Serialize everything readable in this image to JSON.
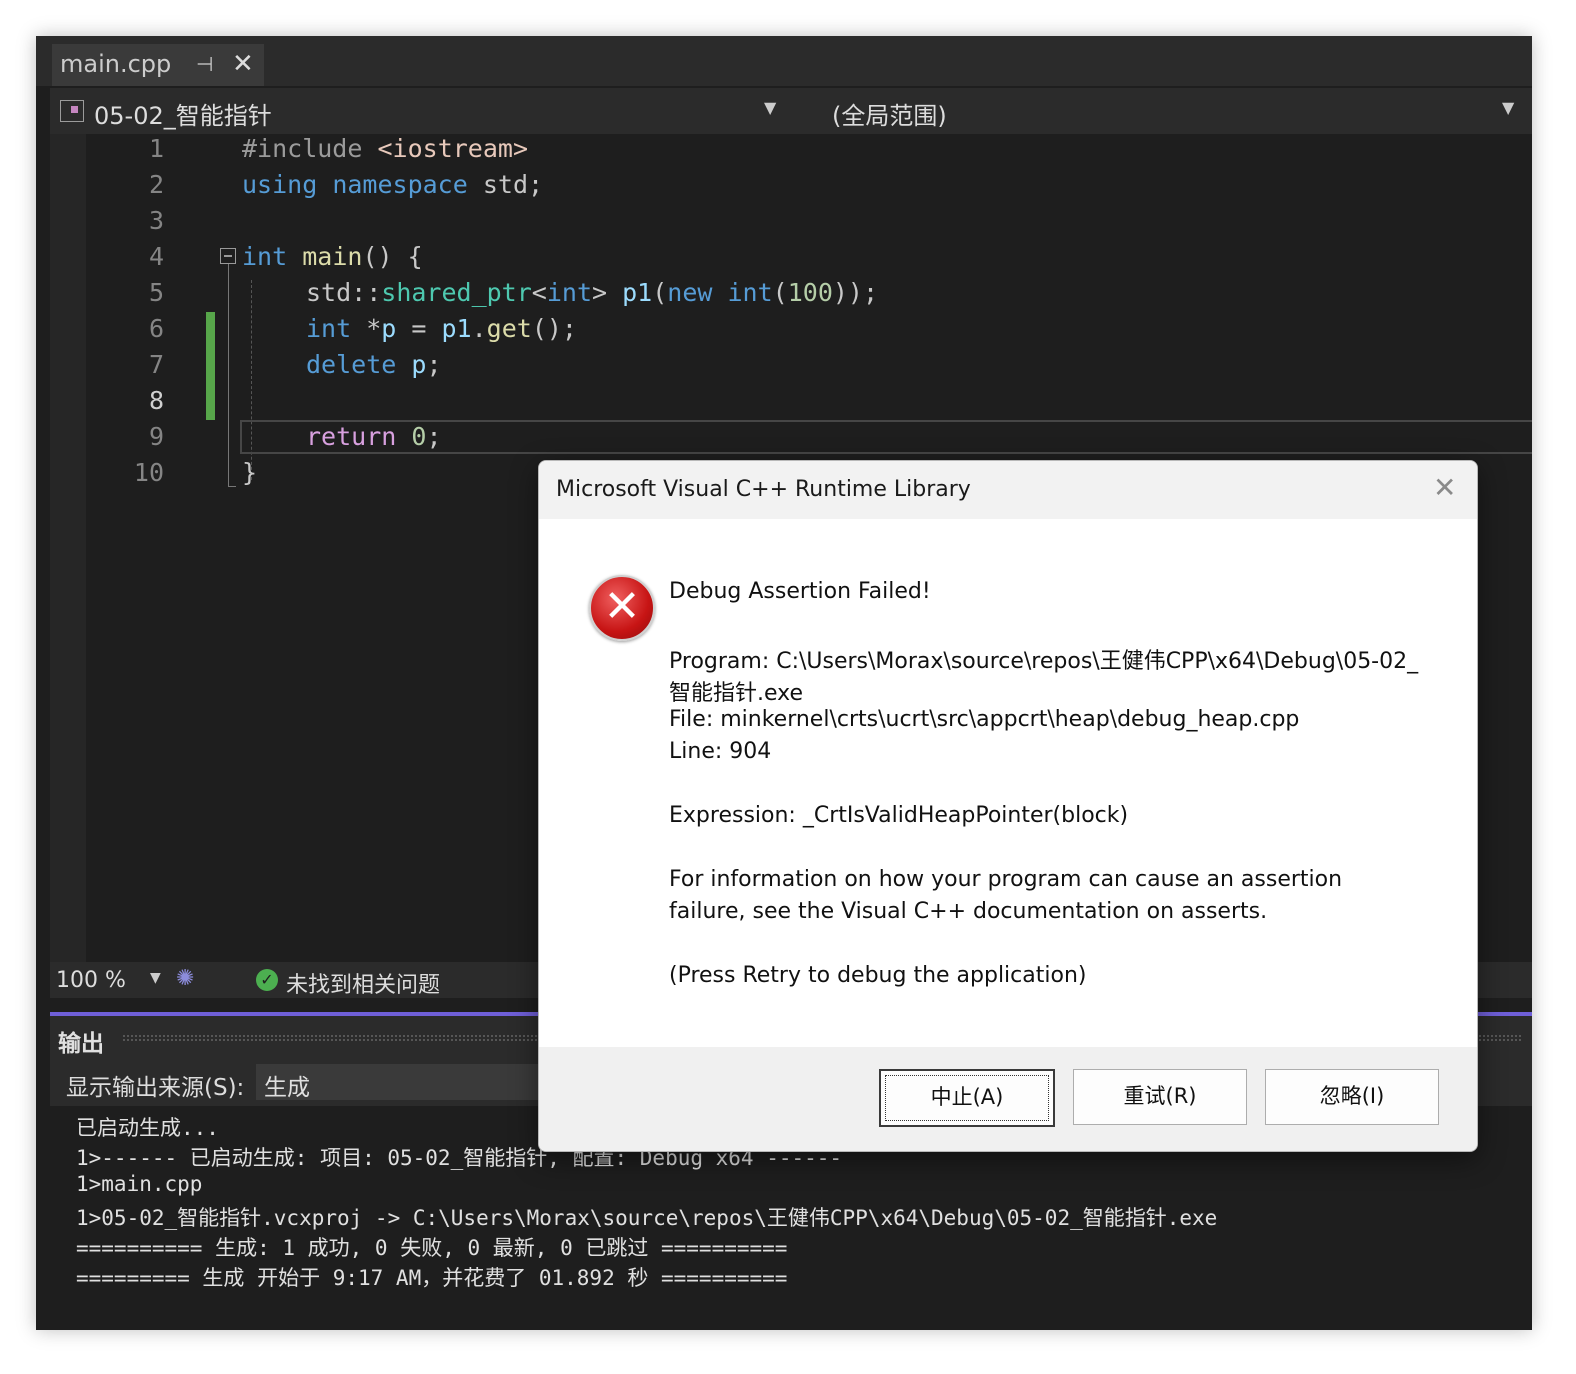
{
  "editor_tab": {
    "filename": "main.cpp",
    "pin_icon": "pin-icon",
    "close_icon": "close-icon"
  },
  "navbar": {
    "project": "05-02_智能指针",
    "scope": "(全局范围)"
  },
  "line_numbers": [
    "1",
    "2",
    "3",
    "4",
    "5",
    "6",
    "7",
    "8",
    "9",
    "10"
  ],
  "code": {
    "l1": {
      "directive": "#include",
      "header": "<iostream>"
    },
    "l2": {
      "kw_using": "using",
      "kw_namespace": "namespace",
      "rest": " std;"
    },
    "l4": {
      "kw_int": "int",
      "fn": "main",
      "rest": "() {"
    },
    "l5": {
      "ns": "std",
      "sep": "::",
      "type": "shared_ptr",
      "lt": "<",
      "kw_int": "int",
      "gt": "> ",
      "var": "p1",
      "paren": "(",
      "kw_new": "new",
      "sp": " ",
      "kw_int2": "int",
      "open": "(",
      "num": "100",
      "close": "));"
    },
    "l6": {
      "kw_int": "int",
      "mid": " *",
      "var_p": "p",
      "eq": " = ",
      "var_p1": "p1",
      "dot": ".",
      "fn": "get",
      "end": "();"
    },
    "l7": {
      "kw_delete": "delete",
      "sp": " ",
      "var_p": "p",
      "end": ";"
    },
    "l9": {
      "kw_return": "return",
      "sp": " ",
      "num": "0",
      "end": ";"
    },
    "l10": {
      "brace": "}"
    }
  },
  "status": {
    "zoom": "100 %",
    "issues": "未找到相关问题"
  },
  "output_panel": {
    "title": "输出",
    "source_label": "显示输出来源(S):",
    "source_value": "生成",
    "lines": [
      "已启动生成...",
      "1>------ 已启动生成: 项目: 05-02_智能指针, 配置: Debug x64 ------",
      "1>main.cpp",
      "1>05-02_智能指针.vcxproj -> C:\\Users\\Morax\\source\\repos\\王健伟CPP\\x64\\Debug\\05-02_智能指针.exe",
      "========== 生成: 1 成功, 0 失败, 0 最新, 0 已跳过 ==========",
      "========= 生成 开始于 9:17 AM，并花费了 01.892 秒 =========="
    ]
  },
  "dialog": {
    "title": "Microsoft Visual C++ Runtime Library",
    "close": "✕",
    "icon": "error-icon",
    "icon_glyph": "✕",
    "heading": "Debug Assertion Failed!",
    "program_line1": "Program: C:\\Users\\Morax\\source\\repos\\王健伟CPP\\x64\\Debug\\05-02_",
    "program_line2": "智能指针.exe",
    "file": "File: minkernel\\crts\\ucrt\\src\\appcrt\\heap\\debug_heap.cpp",
    "line": "Line: 904",
    "expression": "Expression: _CrtIsValidHeapPointer(block)",
    "info_line1": "For information on how your program can cause an assertion",
    "info_line2": "failure, see the Visual C++ documentation on asserts.",
    "press_retry": "(Press Retry to debug the application)",
    "buttons": {
      "abort": "中止(A)",
      "retry": "重试(R)",
      "ignore": "忽略(I)"
    }
  },
  "colors": {
    "accent": "#6f5fd8",
    "change_bar": "#57a64a",
    "error_red": "#c71414"
  }
}
